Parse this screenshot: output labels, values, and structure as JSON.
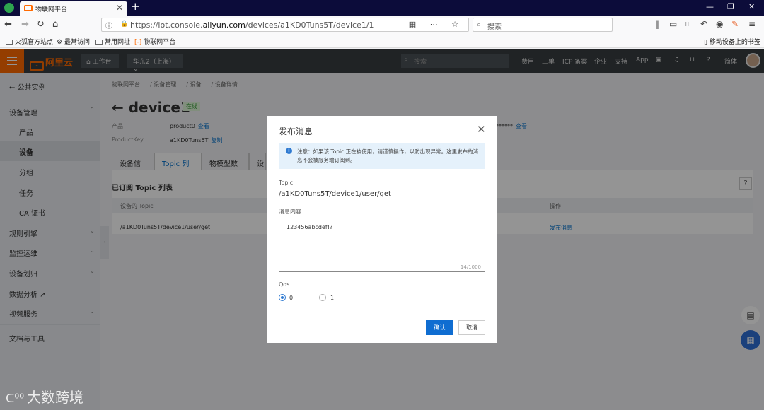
{
  "browser": {
    "tab_title": "物联网平台",
    "tab_close": "✕",
    "new_tab": "+",
    "window_controls": [
      "—",
      "❐",
      "✕"
    ],
    "url_prefix": "https://iot.console.",
    "url_domain": "aliyun.com",
    "url_path": "/devices/a1KD0Tuns5T/device1/1",
    "search_placeholder": "搜索",
    "bookmarks": [
      "火狐官方站点",
      "最常访问",
      "常用网址",
      "物联网平台"
    ],
    "mobile_bookmarks": "移动设备上的书签"
  },
  "header": {
    "logo": "阿里云",
    "workbench": "工作台",
    "region": "华东2（上海）",
    "search_placeholder": "搜索",
    "nav": [
      "费用",
      "工单",
      "ICP 备案",
      "企业",
      "支持",
      "App"
    ],
    "lang": "简体"
  },
  "sidebar": {
    "back": "公共实例",
    "items": [
      {
        "label": "设备管理",
        "type": "group"
      },
      {
        "label": "产品",
        "type": "sub"
      },
      {
        "label": "设备",
        "type": "sub"
      },
      {
        "label": "分组",
        "type": "sub"
      },
      {
        "label": "任务",
        "type": "sub"
      },
      {
        "label": "CA 证书",
        "type": "sub"
      },
      {
        "label": "规则引擎",
        "type": "group"
      },
      {
        "label": "监控运维",
        "type": "group"
      },
      {
        "label": "设备划归",
        "type": "group"
      },
      {
        "label": "数据分析",
        "type": "group"
      },
      {
        "label": "视频服务",
        "type": "group"
      },
      {
        "label": "文档与工具",
        "type": "group"
      }
    ]
  },
  "main": {
    "breadcrumb": [
      "物联网平台",
      "设备管理",
      "设备",
      "设备详情"
    ],
    "device_name": "device1",
    "status_badge": "在线",
    "product_label": "产品",
    "product_value": "product0",
    "view_link": "查看",
    "productkey_label": "ProductKey",
    "productkey_value": "a1KD0Tuns5T",
    "copy_link": "复制",
    "secret_mask": "******",
    "secret_view": "查看",
    "tabs": [
      "设备信息",
      "Topic 列表",
      "物模型数据",
      "设"
    ],
    "section_title": "已订阅 Topic 列表",
    "help": "?",
    "col_topic": "设备的 Topic",
    "col_action": "操作",
    "row_topic": "/a1KD0Tuns5T/device1/user/get",
    "row_action": "发布消息"
  },
  "modal": {
    "title": "发布消息",
    "note": "注意：如果该 Topic 正在被使用，请谨慎操作，以防出现异常。这里发布的消息不会被服务端订阅到。",
    "topic_label": "Topic",
    "topic_value": "/a1KD0Tuns5T/device1/user/get",
    "content_label": "消息内容",
    "content_value": "123456abcdef!?",
    "char_count": "14/1000",
    "qos_label": "Qos",
    "qos_options": [
      "0",
      "1"
    ],
    "qos_selected": "0",
    "confirm": "确认",
    "cancel": "取消"
  },
  "watermark": "大数跨境",
  "colors": {
    "brand": "#ff6a00",
    "primary": "#0f6dd1",
    "topbar": "#373d41"
  }
}
